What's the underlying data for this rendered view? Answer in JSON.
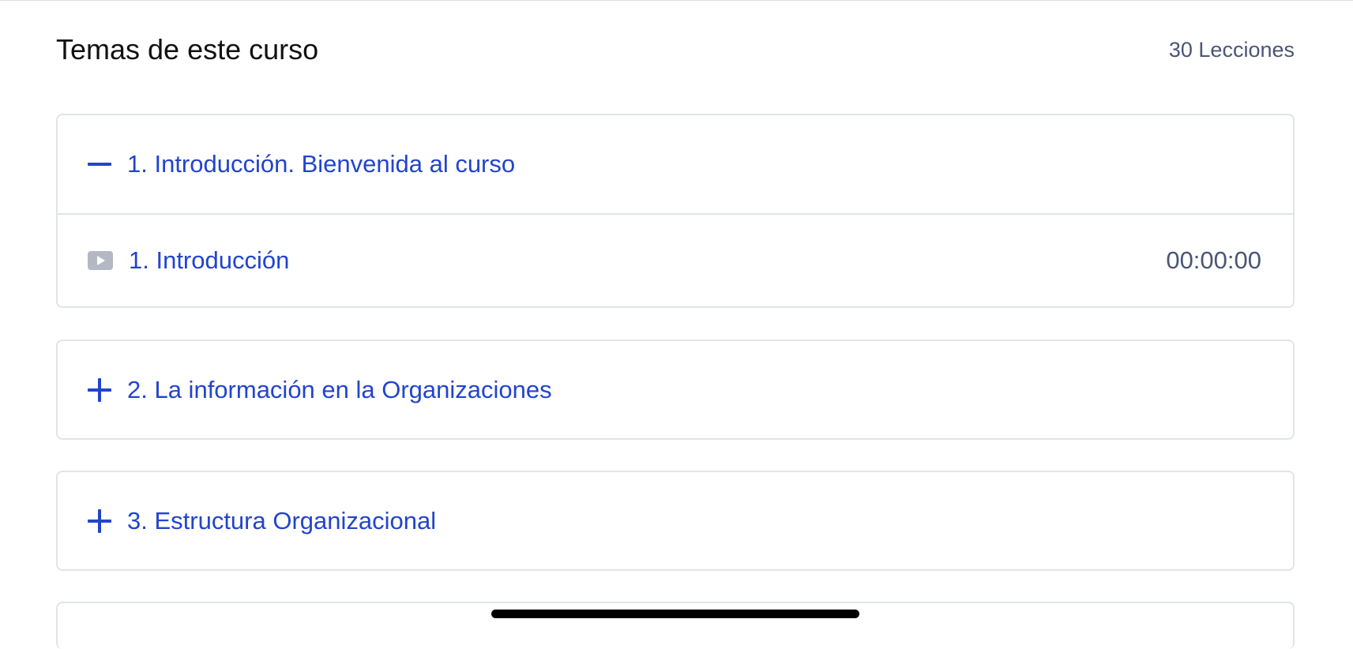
{
  "header": {
    "title": "Temas de este curso",
    "lesson_count": "30 Lecciones"
  },
  "sections": [
    {
      "title": "1. Introducción. Bienvenida al curso",
      "expanded": true,
      "toggle_icon": "minus-icon",
      "lessons": [
        {
          "title": "1. Introducción",
          "duration": "00:00:00",
          "icon": "video-play-icon"
        }
      ]
    },
    {
      "title": "2. La información en la Organizaciones",
      "expanded": false,
      "toggle_icon": "plus-icon"
    },
    {
      "title": "3. Estructura Organizacional",
      "expanded": false,
      "toggle_icon": "plus-icon"
    }
  ],
  "colors": {
    "accent": "#2244cc",
    "muted_text": "#4b5674",
    "border": "#e1e4e8",
    "icon_gray": "#b3b8c4"
  }
}
